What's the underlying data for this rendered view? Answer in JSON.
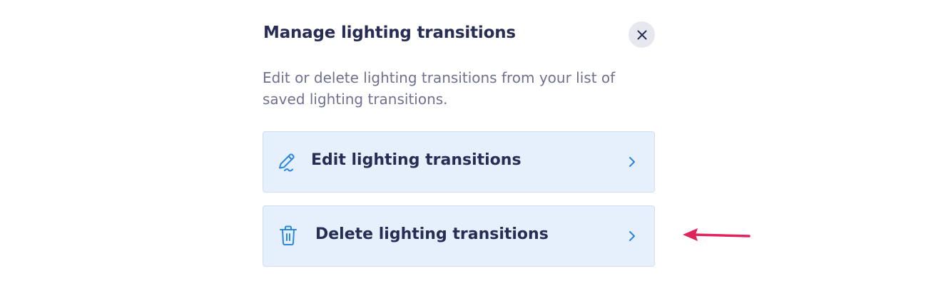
{
  "dialog": {
    "title": "Manage lighting transitions",
    "description": "Edit or delete lighting transitions from your list of saved lighting transitions.",
    "close_icon": "close-icon"
  },
  "actions": [
    {
      "label": "Edit lighting transitions",
      "icon": "pencil-icon",
      "chevron": "chevron-right-icon"
    },
    {
      "label": "Delete lighting transitions",
      "icon": "trash-icon",
      "chevron": "chevron-right-icon"
    }
  ],
  "colors": {
    "title": "#272d55",
    "description": "#6e7290",
    "card_background": "#e5f0fc",
    "card_border": "#cfdff2",
    "icon_accent": "#2b86e0",
    "annotation_arrow": "#e0245e"
  },
  "annotation": {
    "icon": "arrow-left-icon",
    "points_to": "delete-lighting-transitions-button"
  }
}
